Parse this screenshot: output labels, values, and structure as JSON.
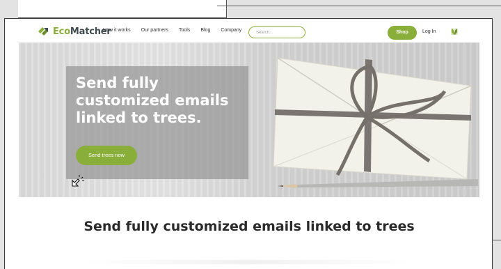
{
  "brand": {
    "name_part1": "Eco",
    "name_part2": "Matcher",
    "accent_color": "#8aae3a",
    "dark_color": "#3e4a4e"
  },
  "nav": {
    "links": [
      {
        "label": "How it works"
      },
      {
        "label": "Our partners"
      },
      {
        "label": "Tools"
      },
      {
        "label": "Blog"
      },
      {
        "label": "Company"
      }
    ],
    "search_placeholder": "Search...",
    "shop_label": "Shop",
    "login_label": "Log In",
    "extra_icon": "leaf-icon"
  },
  "hero": {
    "title": "Send fully customized emails linked to trees.",
    "button_label": "Send trees now",
    "image_subject": "envelope-with-ribbon-and-pencil"
  },
  "section": {
    "title": "Send fully customized emails linked to trees"
  }
}
